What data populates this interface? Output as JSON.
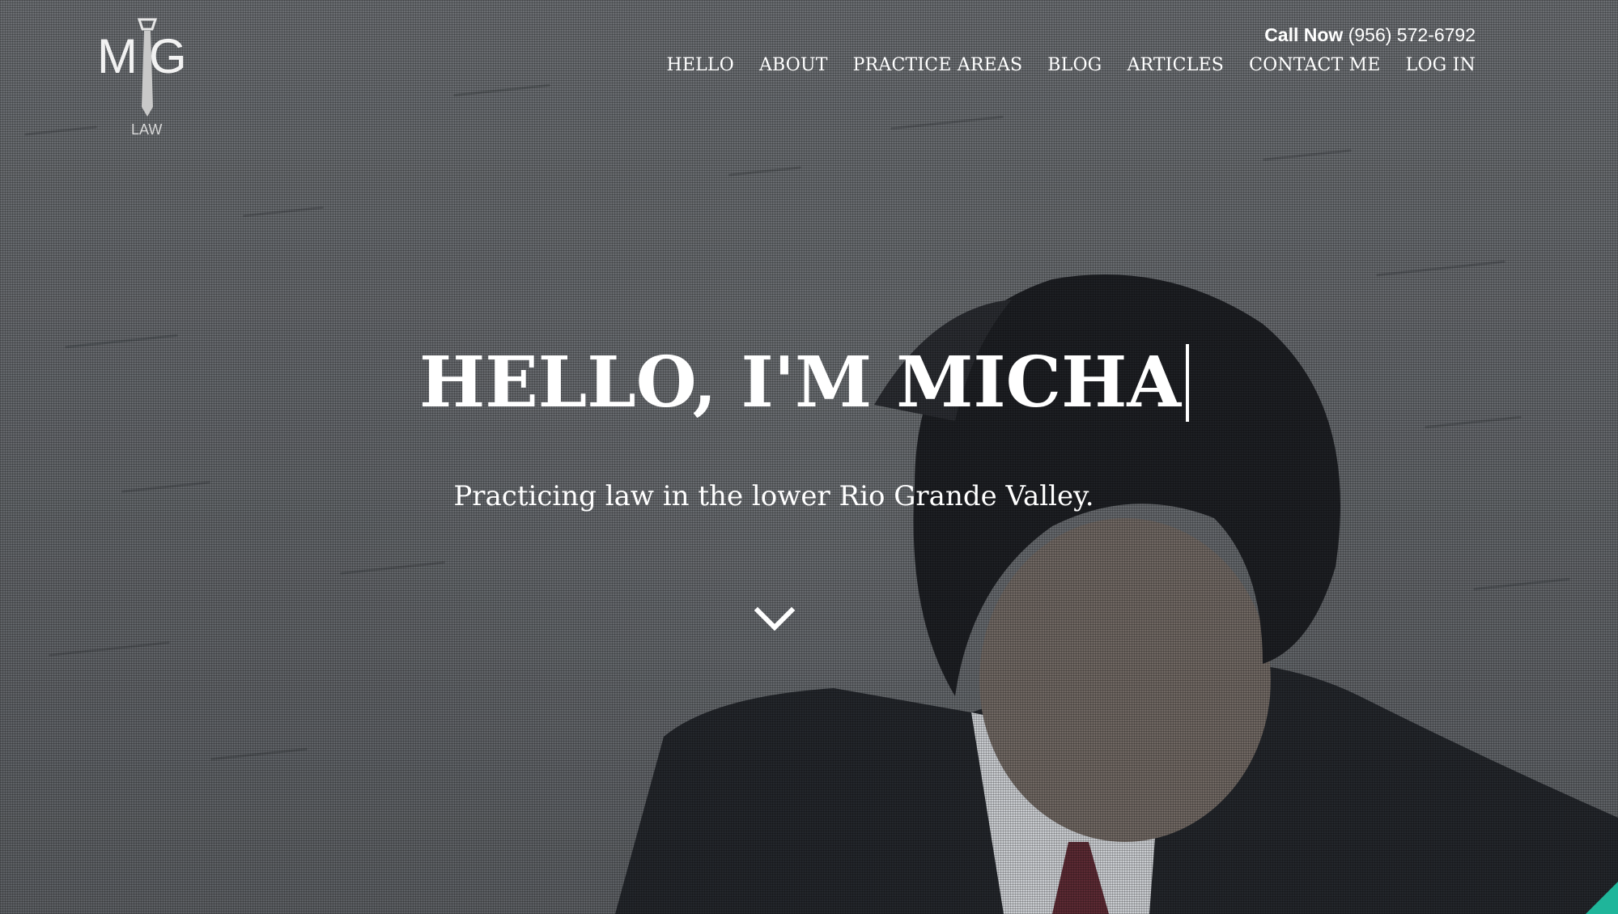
{
  "logo": {
    "initial_left": "M",
    "initial_right": "G",
    "subtitle": "LAW"
  },
  "header": {
    "call_label": "Call Now",
    "phone": "(956) 572-6792"
  },
  "nav": {
    "items": [
      "HELLO",
      "ABOUT",
      "PRACTICE AREAS",
      "BLOG",
      "ARTICLES",
      "CONTACT ME",
      "LOG IN"
    ]
  },
  "hero": {
    "title": "HELLO, I'M MICHA",
    "subtitle": "Practicing law in the lower Rio Grande Valley.",
    "scroll_icon": "chevron-down-icon"
  },
  "colors": {
    "text": "#ffffff",
    "background": "#5a5d61",
    "accent_badge": "#1fb59a"
  }
}
